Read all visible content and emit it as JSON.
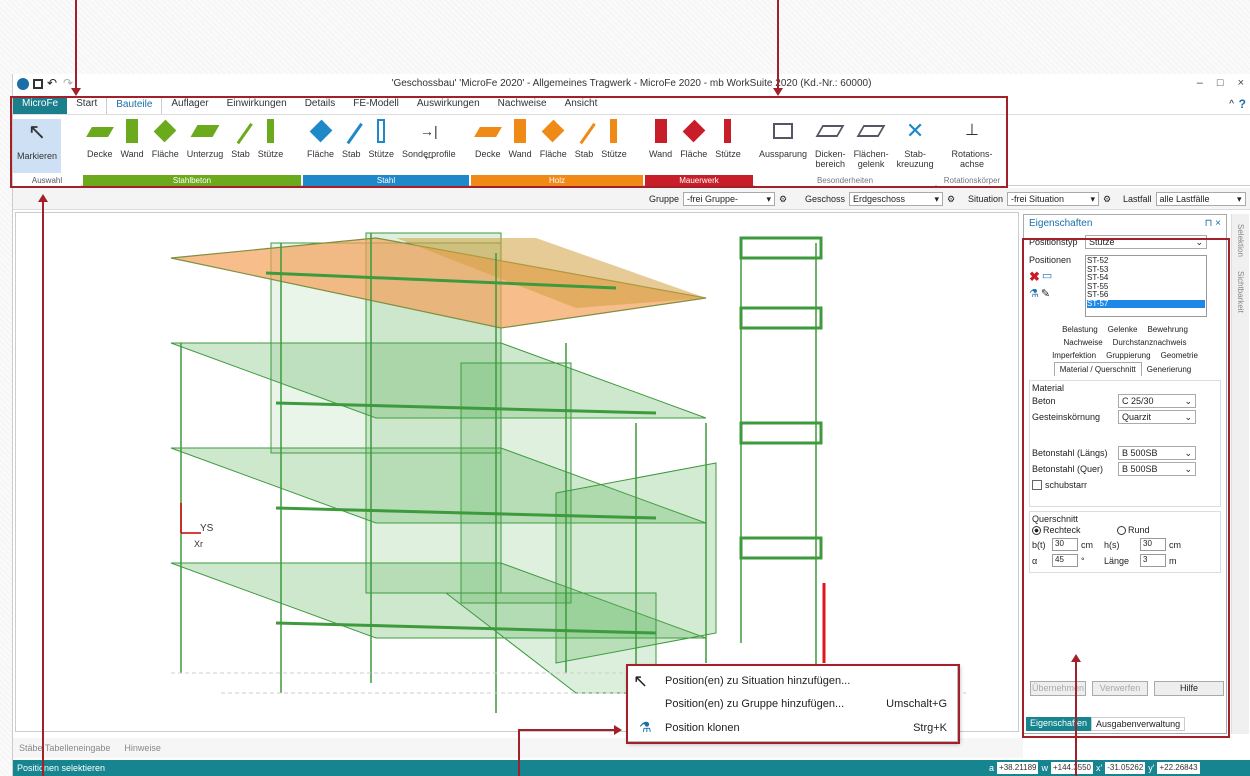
{
  "window": {
    "title": "'Geschossbau' 'MicroFe 2020' -  Allgemeines Tragwerk - MicroFe 2020 - mb WorkSuite 2020 (Kd.-Nr.: 60000)",
    "minimize": "–",
    "maximize": "□",
    "close": "×"
  },
  "ribbon_tabs": [
    "MicroFe",
    "Start",
    "Bauteile",
    "Auflager",
    "Einwirkungen",
    "Details",
    "FE-Modell",
    "Auswirkungen",
    "Nachweise",
    "Ansicht"
  ],
  "groups": {
    "auswahl": {
      "label": "Auswahl",
      "items": [
        "Markieren"
      ]
    },
    "stahlbeton": {
      "label": "Stahlbeton",
      "items": [
        "Decke",
        "Wand",
        "Fläche",
        "Unterzug",
        "Stab",
        "Stütze"
      ],
      "color": "#6aaa1c"
    },
    "stahl": {
      "label": "Stahl",
      "items": [
        "Fläche",
        "Stab",
        "Stütze",
        "Sonderprofile"
      ],
      "color": "#1e88c8"
    },
    "holz": {
      "label": "Holz",
      "items": [
        "Decke",
        "Wand",
        "Fläche",
        "Stab",
        "Stütze"
      ],
      "color": "#f08a16"
    },
    "mauerwerk": {
      "label": "Mauerwerk",
      "items": [
        "Wand",
        "Fläche",
        "Stütze"
      ],
      "color": "#c81e2a"
    },
    "besonderheiten": {
      "label": "Besonderheiten",
      "items": [
        "Aussparung",
        "Dicken-\nbereich",
        "Flächen-\ngelenk",
        "Stab-\nkreuzung"
      ]
    },
    "rotationskoerper": {
      "label": "Rotationskörper",
      "items": [
        "Rotations-\nachse"
      ]
    }
  },
  "toolbar2": {
    "gruppe_label": "Gruppe",
    "gruppe_value": "-frei Gruppe-",
    "geschoss_label": "Geschoss",
    "geschoss_value": "Erdgeschoss",
    "situation_label": "Situation",
    "situation_value": "-frei Situation",
    "lastfall_label": "Lastfall",
    "lastfall_value": "alle Lastfälle"
  },
  "panel": {
    "title": "Eigenschaften",
    "positionstyp_label": "Positionstyp",
    "positionstyp_value": "Stütze",
    "positionen_label": "Positionen",
    "positionen": [
      "ST-52",
      "ST-53",
      "ST-54",
      "ST-55",
      "ST-56",
      "ST-57"
    ],
    "tabs_row1": [
      "Belastung",
      "Gelenke",
      "Bewehrung"
    ],
    "tabs_row2": [
      "Nachweise",
      "Durchstanznachweis"
    ],
    "tabs_row3": [
      "Imperfektion",
      "Gruppierung",
      "Geometrie"
    ],
    "tabs_row4": [
      "Material / Querschnitt",
      "Generierung"
    ],
    "material_group": "Material",
    "beton_label": "Beton",
    "beton_value": "C 25/30",
    "gestein_label": "Gesteinskörnung",
    "gestein_value": "Quarzit",
    "laengs_label": "Betonstahl (Längs)",
    "laengs_value": "B 500SB",
    "quer_label": "Betonstahl (Quer)",
    "quer_value": "B 500SB",
    "schubstarr": "schubstarr",
    "querschnitt_group": "Querschnitt",
    "rechteck": "Rechteck",
    "rund": "Rund",
    "b_label": "b(t)",
    "b_value": "30",
    "b_unit": "cm",
    "h_label": "h(s)",
    "h_value": "30",
    "h_unit": "cm",
    "alpha_label": "α",
    "alpha_value": "45",
    "alpha_unit": "°",
    "laenge_label": "Länge",
    "laenge_value": "3",
    "laenge_unit": "m",
    "uebernehmen": "Übernehmen",
    "verwerfen": "Verwerfen",
    "hilfe": "Hilfe",
    "bottom_tab1": "Eigenschaften",
    "bottom_tab2": "Ausgabenverwaltung"
  },
  "sidebar": {
    "selektion": "Selektion",
    "sichtbarkeit": "Sichtbarkeit"
  },
  "bottom_tabs": [
    "Stäbe Tabelleneingabe",
    "Hinweise"
  ],
  "status": {
    "text": "Positionen selektieren",
    "a_label": "a",
    "a_value": "+38.21189",
    "w_label": "w",
    "w_value": "+144.3550",
    "x_label": "x'",
    "x_value": "-31.05262",
    "y_label": "y'",
    "y_value": "+22.26843"
  },
  "context_menu": {
    "item1": "Position(en) zu Situation hinzufügen...",
    "item2": "Position(en) zu Gruppe hinzufügen...",
    "item2_shortcut": "Umschalt+G",
    "item3": "Position klonen",
    "item3_shortcut": "Strg+K"
  },
  "axis": {
    "x": "Xr",
    "y": "YS"
  }
}
